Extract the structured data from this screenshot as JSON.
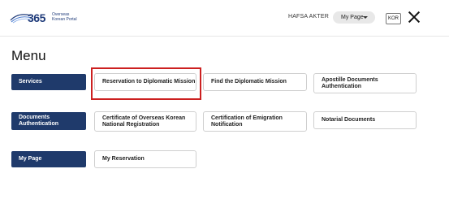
{
  "header": {
    "logo_number": "365",
    "logo_subtitle_line1": "Overseas",
    "logo_subtitle_line2": "Korean Portal",
    "user_name": "HAFSA AKTER",
    "mypage_select": "My Page",
    "language": "KOR"
  },
  "menu_title": "Menu",
  "sections": [
    {
      "label": "Services",
      "items": [
        "Reservation to Diplomatic Mission",
        "Find the Diplomatic Mission",
        "Apostille Documents Authentication"
      ]
    },
    {
      "label": "Documents Authentication",
      "items": [
        "Certificate of Overseas Korean National Registration",
        "Certification of Emigration Notification",
        "Notarial Documents"
      ]
    },
    {
      "label": "My Page",
      "items": [
        "My Reservation"
      ]
    }
  ],
  "colors": {
    "brand_navy": "#1f3a6b",
    "highlight_red": "#cc2020"
  }
}
